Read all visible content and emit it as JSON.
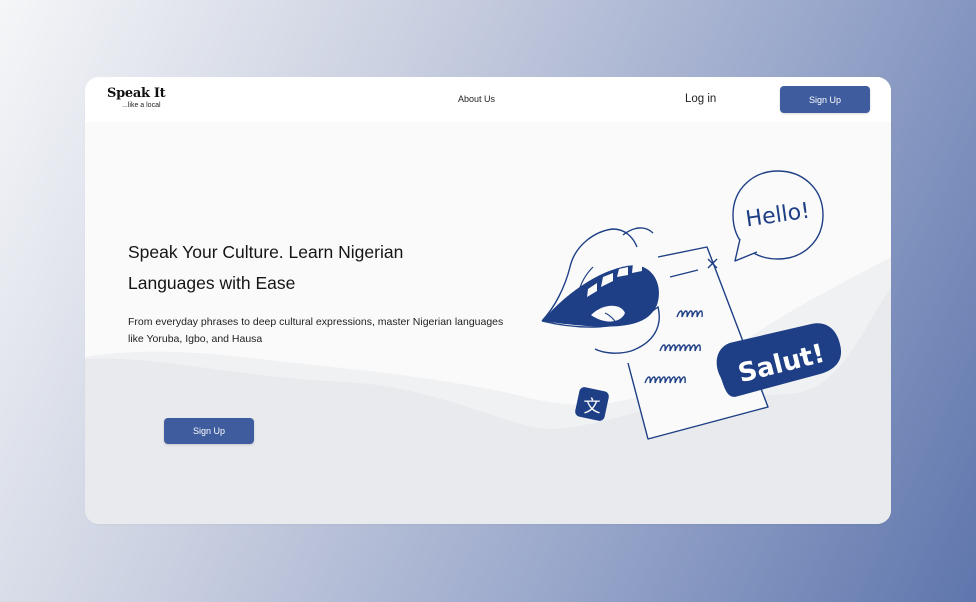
{
  "brand": {
    "name": "Speak It",
    "tagline": "...like a local"
  },
  "nav": {
    "about_label": "About Us",
    "login_label": "Log in",
    "signup_label": "Sign Up"
  },
  "hero": {
    "title": "Speak Your Culture. Learn Nigerian Languages with Ease",
    "subtitle": "From everyday phrases to deep cultural expressions, master Nigerian languages like Yoruba, Igbo, and Hausa",
    "cta_label": "Sign Up"
  },
  "illustration": {
    "bubble_hello": "Hello!",
    "bubble_salut": "Salut!",
    "translate_glyph": "文",
    "icons": [
      "mouth-icon",
      "document-icon",
      "speech-bubble-icon",
      "translate-icon"
    ]
  },
  "colors": {
    "accent": "#3e5c9e",
    "illustration_blue": "#1e3f85",
    "card_bg": "#fafafa"
  }
}
